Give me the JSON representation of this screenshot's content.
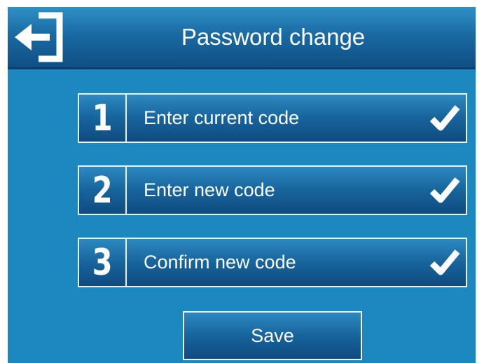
{
  "header": {
    "title": "Password change",
    "back_icon": "exit-arrow-icon"
  },
  "steps": [
    {
      "number": "1",
      "label": "Enter current code",
      "done": true,
      "icon": "checkmark-icon"
    },
    {
      "number": "2",
      "label": "Enter new code",
      "done": true,
      "icon": "checkmark-icon"
    },
    {
      "number": "3",
      "label": "Confirm new code",
      "done": true,
      "icon": "checkmark-icon"
    }
  ],
  "save_label": "Save",
  "colors": {
    "background": "#1b88c0",
    "header": "#0f4f85",
    "button_border": "#e8f2f8",
    "text": "#ffffff"
  }
}
